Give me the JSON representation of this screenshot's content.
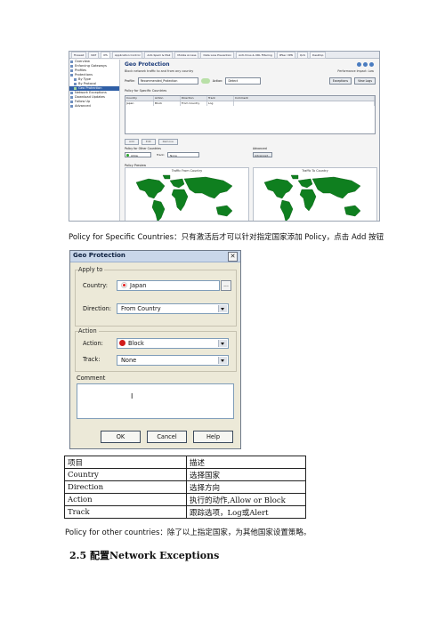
{
  "screenshot1": {
    "tabs": [
      "Firewall",
      "NAT",
      "IPS",
      "Application Control",
      "Anti-Spam & Mail",
      "Mobile Access",
      "Data Loss Prevention",
      "Anti-Virus & URL Filtering",
      "IPSec VPN",
      "QoS",
      "Desktop"
    ],
    "tree_nodes": [
      "Overview",
      "Enforcing Gateways",
      "Profiles",
      "Protections",
      "By Type",
      "By Protocol",
      "Geo Protection",
      "Network Exceptions",
      "Download Updates",
      "Follow Up",
      "Advanced"
    ],
    "pane_title": "Geo Protection",
    "pane_subtitle": "Block network traffic to and from any country",
    "performance_note": "Performance Impact:",
    "performance_value": "Low",
    "profile_label": "Profile:",
    "profile_value": "Recommended_Protection",
    "action_label": "Action:",
    "action_value": "Detect",
    "exceptions_button": "Exceptions",
    "view_logs_button": "View Logs",
    "specific_label": "Policy for Specific Countries",
    "grid_headers": [
      "Country",
      "Action",
      "Direction",
      "Track",
      "Comment"
    ],
    "grid_rows": [
      [
        "Japan",
        "Block",
        "From Country",
        "Log",
        ""
      ]
    ],
    "add_button": "Add",
    "edit_button": "Edit",
    "remove_button": "Remove",
    "other_label": "Policy for Other Countries",
    "other_action": "Allow",
    "track_label": "Track:",
    "track_value": "None",
    "advanced_label": "Advanced",
    "advanced_button": "Advanced...",
    "preview_label": "Policy Preview",
    "map_left_caption": "Traffic From Country",
    "map_right_caption": "Traffic To Country"
  },
  "caption1": "Policy for Specific Countries：只有激活后才可以针对指定国家添加 Policy，点击 Add 按钮",
  "dialog": {
    "title": "Geo Protection",
    "apply_to": "Apply to",
    "country_label": "Country:",
    "country_value": "Japan",
    "ellipsis_label": "...",
    "direction_label": "Direction:",
    "direction_value": "From Country",
    "action_section": "Action",
    "action_label": "Action:",
    "action_value": "Block",
    "track_label": "Track:",
    "track_value": "None",
    "comment_label": "Comment",
    "ok": "OK",
    "cancel": "Cancel",
    "help": "Help",
    "colors": {
      "block": "#d21b1b",
      "japan_dot": "#e32020"
    }
  },
  "table": {
    "header": [
      "项目",
      "描述"
    ],
    "rows": [
      [
        "Country",
        "选择国家"
      ],
      [
        "Direction",
        "选择方向"
      ],
      [
        "Action",
        "执行的动作,Allow or Block"
      ],
      [
        "Track",
        "跟踪选项，Log或Alert"
      ]
    ]
  },
  "caption2": "Policy for other countries：除了以上指定国家，为其他国家设置策略。",
  "heading": "2.5 配置Network Exceptions"
}
